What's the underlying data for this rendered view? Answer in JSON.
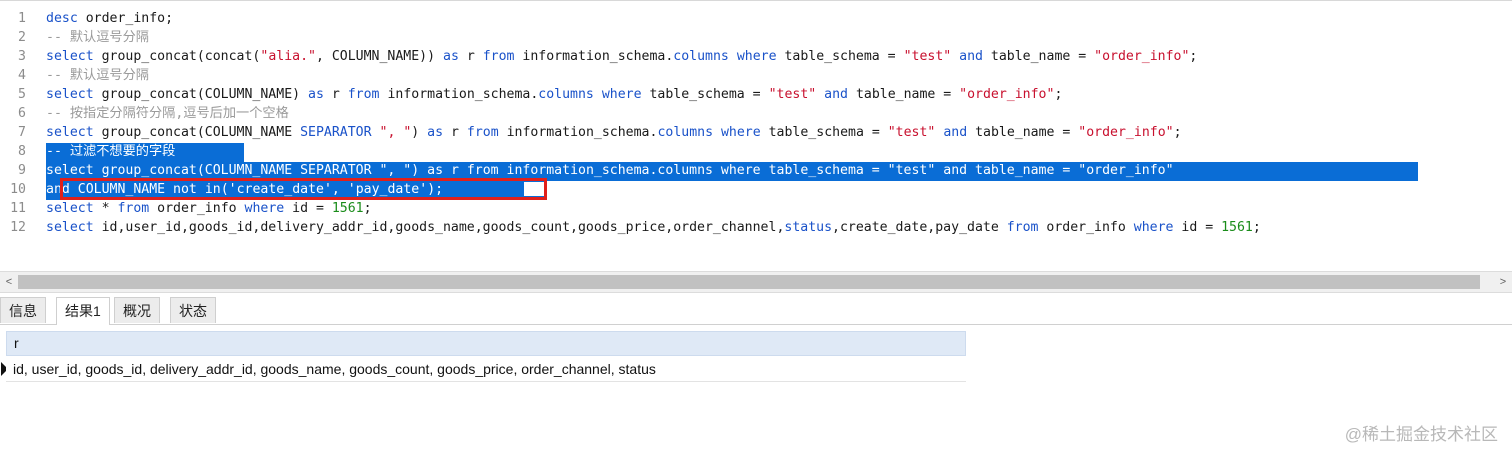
{
  "editor": {
    "lines": [
      {
        "n": "1",
        "tokens": [
          [
            "kw",
            "desc"
          ],
          [
            "fn",
            " order_info;"
          ]
        ]
      },
      {
        "n": "2",
        "tokens": [
          [
            "cm",
            "-- 默认逗号分隔"
          ]
        ]
      },
      {
        "n": "3",
        "tokens": [
          [
            "kw",
            "select"
          ],
          [
            "fn",
            " group_concat(concat("
          ],
          [
            "str",
            "\"alia.\""
          ],
          [
            "fn",
            ", COLUMN_NAME)) "
          ],
          [
            "kw",
            "as"
          ],
          [
            "fn",
            " r "
          ],
          [
            "kw",
            "from"
          ],
          [
            "fn",
            " information_schema."
          ],
          [
            "col",
            "columns"
          ],
          [
            "fn",
            " "
          ],
          [
            "kw",
            "where"
          ],
          [
            "fn",
            " table_schema = "
          ],
          [
            "str",
            "\"test\""
          ],
          [
            "fn",
            " "
          ],
          [
            "kw",
            "and"
          ],
          [
            "fn",
            " table_name = "
          ],
          [
            "str",
            "\"order_info\""
          ],
          [
            "fn",
            ";"
          ]
        ]
      },
      {
        "n": "4",
        "tokens": [
          [
            "cm",
            "-- 默认逗号分隔"
          ]
        ]
      },
      {
        "n": "5",
        "tokens": [
          [
            "kw",
            "select"
          ],
          [
            "fn",
            " group_concat(COLUMN_NAME) "
          ],
          [
            "kw",
            "as"
          ],
          [
            "fn",
            " r "
          ],
          [
            "kw",
            "from"
          ],
          [
            "fn",
            " information_schema."
          ],
          [
            "col",
            "columns"
          ],
          [
            "fn",
            " "
          ],
          [
            "kw",
            "where"
          ],
          [
            "fn",
            " table_schema = "
          ],
          [
            "str",
            "\"test\""
          ],
          [
            "fn",
            " "
          ],
          [
            "kw",
            "and"
          ],
          [
            "fn",
            " table_name = "
          ],
          [
            "str",
            "\"order_info\""
          ],
          [
            "fn",
            ";"
          ]
        ]
      },
      {
        "n": "6",
        "tokens": [
          [
            "cm",
            "-- 按指定分隔符分隔,逗号后加一个空格"
          ]
        ]
      },
      {
        "n": "7",
        "tokens": [
          [
            "kw",
            "select"
          ],
          [
            "fn",
            " group_concat(COLUMN_NAME "
          ],
          [
            "kw",
            "SEPARATOR"
          ],
          [
            "fn",
            " "
          ],
          [
            "str",
            "\", \""
          ],
          [
            "fn",
            ") "
          ],
          [
            "kw",
            "as"
          ],
          [
            "fn",
            " r "
          ],
          [
            "kw",
            "from"
          ],
          [
            "fn",
            " information_schema."
          ],
          [
            "col",
            "columns"
          ],
          [
            "fn",
            " "
          ],
          [
            "kw",
            "where"
          ],
          [
            "fn",
            " table_schema = "
          ],
          [
            "str",
            "\"test\""
          ],
          [
            "fn",
            " "
          ],
          [
            "kw",
            "and"
          ],
          [
            "fn",
            " table_name = "
          ],
          [
            "str",
            "\"order_info\""
          ],
          [
            "fn",
            ";"
          ]
        ]
      },
      {
        "n": "8",
        "tokens": [
          [
            "cm",
            "-- 过滤不想要的字段"
          ]
        ],
        "selected": true
      },
      {
        "n": "9",
        "tokens": [
          [
            "kw",
            "select"
          ],
          [
            "fn",
            " group_concat(COLUMN_NAME SEPARATOR "
          ],
          [
            "str",
            "\", \""
          ],
          [
            "fn",
            ") "
          ],
          [
            "kw",
            "as"
          ],
          [
            "fn",
            " r "
          ],
          [
            "kw",
            "from"
          ],
          [
            "fn",
            " information_schema.columns "
          ],
          [
            "kw",
            "where"
          ],
          [
            "fn",
            " table_schema = "
          ],
          [
            "str",
            "\"test\""
          ],
          [
            "fn",
            " "
          ],
          [
            "kw",
            "and"
          ],
          [
            "fn",
            " table_name = "
          ],
          [
            "str",
            "\"order_info\""
          ]
        ],
        "selected": true
      },
      {
        "n": "10",
        "tokens": [
          [
            "kw",
            "and"
          ],
          [
            "fn",
            " COLUMN_NAME "
          ],
          [
            "kw",
            "not"
          ],
          [
            "fn",
            " "
          ],
          [
            "kw",
            "in"
          ],
          [
            "fn",
            "("
          ],
          [
            "str",
            "'create_date'"
          ],
          [
            "fn",
            ", "
          ],
          [
            "str",
            "'pay_date'"
          ],
          [
            "fn",
            ");"
          ]
        ],
        "selected": true
      },
      {
        "n": "11",
        "tokens": [
          [
            "kw",
            "select"
          ],
          [
            "fn",
            " * "
          ],
          [
            "kw",
            "from"
          ],
          [
            "fn",
            " order_info "
          ],
          [
            "kw",
            "where"
          ],
          [
            "fn",
            " id = "
          ],
          [
            "num",
            "1561"
          ],
          [
            "fn",
            ";"
          ]
        ]
      },
      {
        "n": "12",
        "tokens": [
          [
            "kw",
            "select"
          ],
          [
            "fn",
            " id,user_id,goods_id,delivery_addr_id,goods_name,goods_count,goods_price,order_channel,"
          ],
          [
            "col",
            "status"
          ],
          [
            "fn",
            ",create_date,pay_date "
          ],
          [
            "kw",
            "from"
          ],
          [
            "fn",
            " order_info "
          ],
          [
            "kw",
            "where"
          ],
          [
            "fn",
            " id = "
          ],
          [
            "num",
            "1561"
          ],
          [
            "fn",
            ";"
          ]
        ]
      }
    ]
  },
  "scrollbar": {
    "left_arrow": "<",
    "right_arrow": ">"
  },
  "tabs": [
    {
      "label": "信息"
    },
    {
      "label": "结果1",
      "active": true
    },
    {
      "label": "概况"
    },
    {
      "label": "状态"
    }
  ],
  "result": {
    "column_header": "r",
    "row_value": "id, user_id, goods_id, delivery_addr_id, goods_name, goods_count, goods_price, order_channel, status"
  },
  "watermark": "@稀土掘金技术社区"
}
